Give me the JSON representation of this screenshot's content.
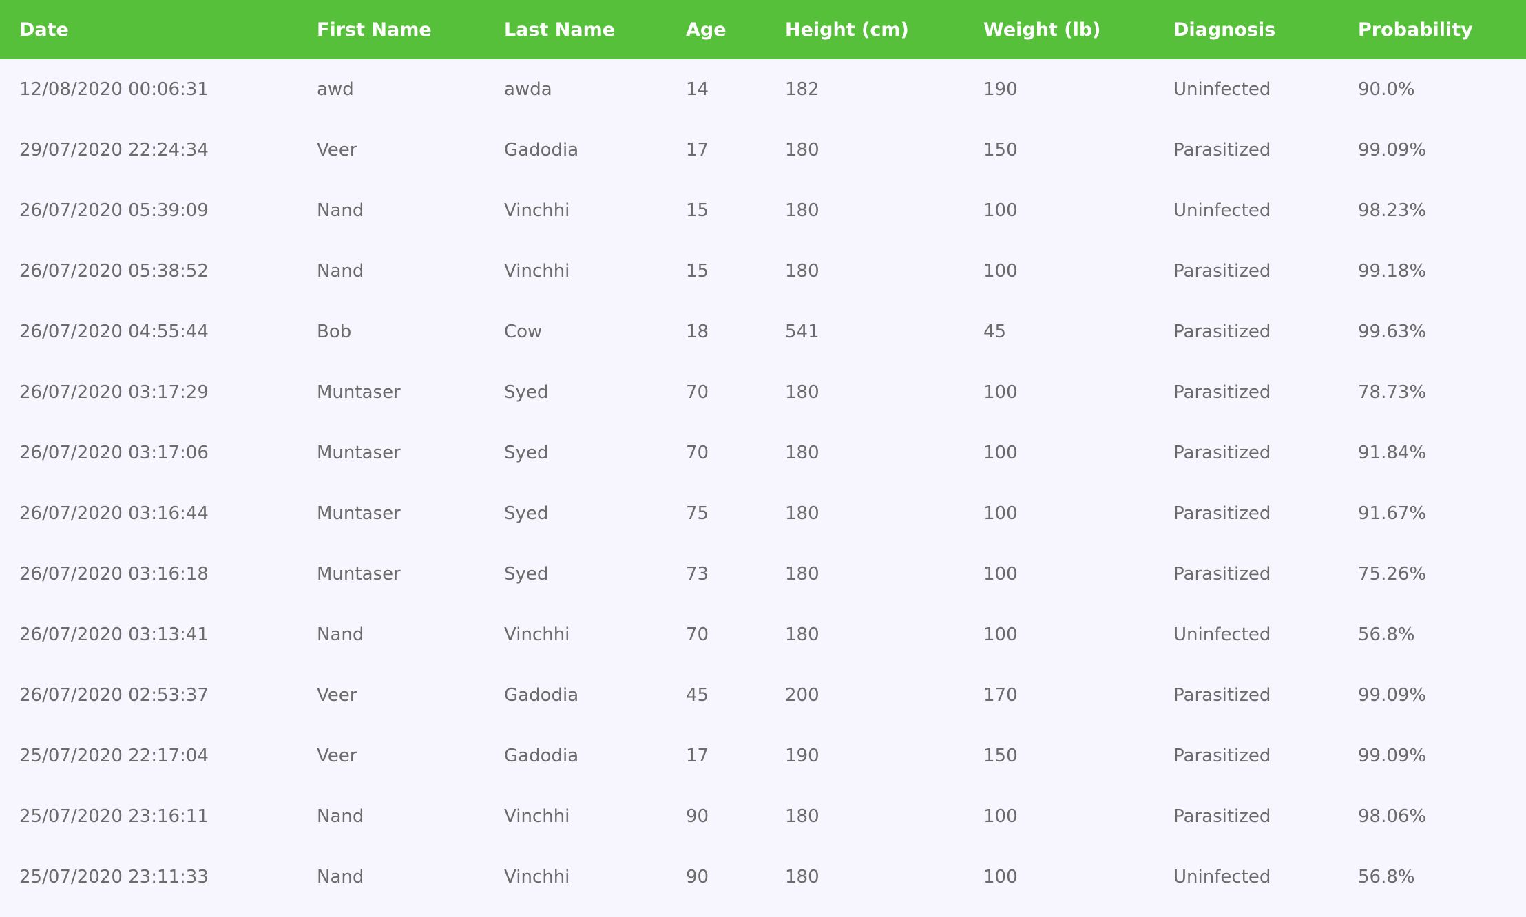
{
  "table": {
    "headers": [
      "Date",
      "First Name",
      "Last Name",
      "Age",
      "Height (cm)",
      "Weight (lb)",
      "Diagnosis",
      "Probability"
    ],
    "rows": [
      [
        "12/08/2020 00:06:31",
        "awd",
        "awda",
        "14",
        "182",
        "190",
        "Uninfected",
        "90.0%"
      ],
      [
        "29/07/2020 22:24:34",
        "Veer",
        "Gadodia",
        "17",
        "180",
        "150",
        "Parasitized",
        "99.09%"
      ],
      [
        "26/07/2020 05:39:09",
        "Nand",
        "Vinchhi",
        "15",
        "180",
        "100",
        "Uninfected",
        "98.23%"
      ],
      [
        "26/07/2020 05:38:52",
        "Nand",
        "Vinchhi",
        "15",
        "180",
        "100",
        "Parasitized",
        "99.18%"
      ],
      [
        "26/07/2020 04:55:44",
        "Bob",
        "Cow",
        "18",
        "541",
        "45",
        "Parasitized",
        "99.63%"
      ],
      [
        "26/07/2020 03:17:29",
        "Muntaser",
        "Syed",
        "70",
        "180",
        "100",
        "Parasitized",
        "78.73%"
      ],
      [
        "26/07/2020 03:17:06",
        "Muntaser",
        "Syed",
        "70",
        "180",
        "100",
        "Parasitized",
        "91.84%"
      ],
      [
        "26/07/2020 03:16:44",
        "Muntaser",
        "Syed",
        "75",
        "180",
        "100",
        "Parasitized",
        "91.67%"
      ],
      [
        "26/07/2020 03:16:18",
        "Muntaser",
        "Syed",
        "73",
        "180",
        "100",
        "Parasitized",
        "75.26%"
      ],
      [
        "26/07/2020 03:13:41",
        "Nand",
        "Vinchhi",
        "70",
        "180",
        "100",
        "Uninfected",
        "56.8%"
      ],
      [
        "26/07/2020 02:53:37",
        "Veer",
        "Gadodia",
        "45",
        "200",
        "170",
        "Parasitized",
        "99.09%"
      ],
      [
        "25/07/2020 22:17:04",
        "Veer",
        "Gadodia",
        "17",
        "190",
        "150",
        "Parasitized",
        "99.09%"
      ],
      [
        "25/07/2020 23:16:11",
        "Nand",
        "Vinchhi",
        "90",
        "180",
        "100",
        "Parasitized",
        "98.06%"
      ],
      [
        "25/07/2020 23:11:33",
        "Nand",
        "Vinchhi",
        "90",
        "180",
        "100",
        "Uninfected",
        "56.8%"
      ]
    ]
  },
  "colors": {
    "header_background": "#57c03b",
    "header_text": "#ffffff",
    "page_background": "#f7f5fd",
    "cell_text": "#6b6b6b"
  }
}
